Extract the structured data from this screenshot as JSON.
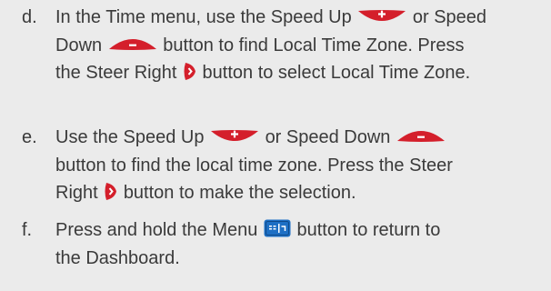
{
  "steps": [
    {
      "letter": "d.",
      "lines": [
        [
          "In the Time menu, use the Speed Up ",
          " or Speed"
        ],
        [
          "Down ",
          " button to find Local Time Zone. Press"
        ],
        [
          "the Steer Right ",
          " button to select Local Time Zone."
        ]
      ]
    },
    {
      "letter": "e.",
      "lines": [
        [
          "Use the Speed Up ",
          " or Speed Down "
        ],
        [
          "button to find the local time zone. Press the Steer"
        ],
        [
          "Right ",
          " button to make the selection."
        ]
      ]
    },
    {
      "letter": "f.",
      "lines": [
        [
          "Press and hold the Menu ",
          " button to return to"
        ],
        [
          "the Dashboard."
        ]
      ]
    }
  ],
  "icons": {
    "speed_up": "speed-up-button-icon",
    "speed_down": "speed-down-button-icon",
    "steer_right": "steer-right-button-icon",
    "menu": "menu-button-icon"
  },
  "colors": {
    "background": "#ebebeb",
    "text": "#3a3a3a",
    "button_red": "#d41f2b",
    "button_blue": "#1d6fc4"
  }
}
